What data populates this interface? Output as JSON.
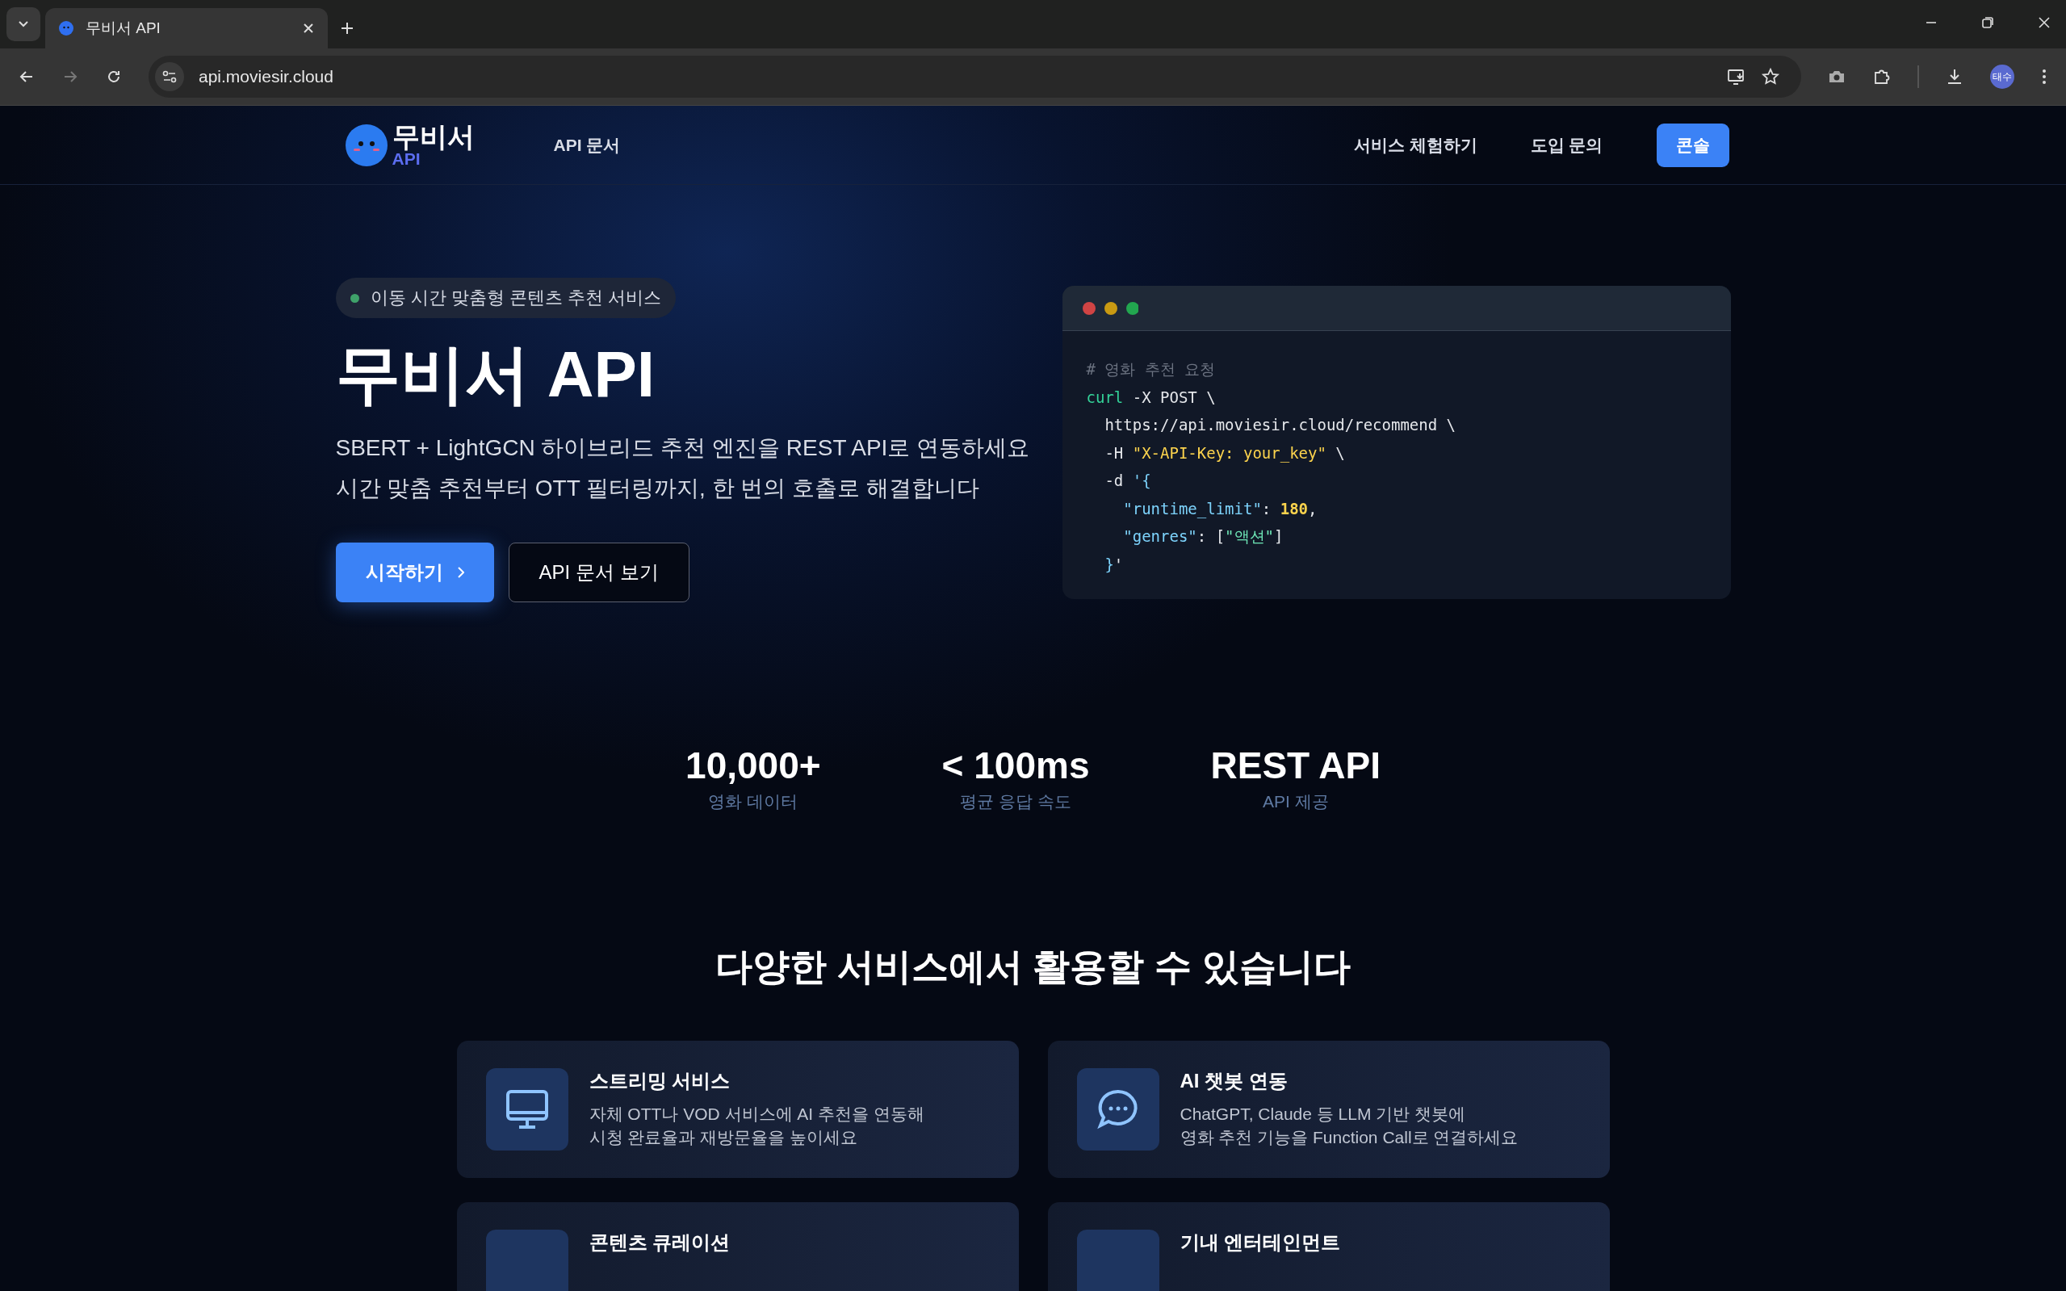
{
  "browser": {
    "tab_title": "무비서 API",
    "url": "api.moviesir.cloud",
    "profile": "태수"
  },
  "nav": {
    "logo_text": "무비서",
    "logo_sub": "API",
    "links": [
      {
        "label": "API 문서"
      }
    ],
    "right_links": [
      {
        "label": "서비스 체험하기"
      },
      {
        "label": "도입 문의"
      }
    ],
    "console_button": "콘솔"
  },
  "hero": {
    "badge": "이동 시간 맞춤형 콘텐츠 추천 서비스",
    "title": "무비서 API",
    "subtitle": [
      "SBERT + LightGCN 하이브리드 추천 엔진을 REST API로 연동하세요",
      "시간 맞춤 추천부터 OTT 필터링까지, 한 번의 호출로 해결합니다"
    ],
    "buttons": [
      {
        "label": "시작하기",
        "kind": "primary"
      },
      {
        "label": "API 문서 보기",
        "kind": "outline"
      }
    ]
  },
  "code": {
    "lines": [
      [
        {
          "t": "# 영화 추천 요청",
          "kind": "comment"
        }
      ],
      [
        {
          "t": "curl",
          "kind": "command"
        },
        {
          "t": " -X POST \\",
          "kind": "plain"
        }
      ],
      [
        {
          "t": "  https://api.moviesir.cloud/recommend \\",
          "kind": "plain"
        }
      ],
      [
        {
          "t": "  -H ",
          "kind": "plain"
        },
        {
          "t": "\"X-API-Key: your_key\"",
          "kind": "string"
        },
        {
          "t": " \\",
          "kind": "plain"
        }
      ],
      [
        {
          "t": "  -d ",
          "kind": "plain"
        },
        {
          "t": "'{",
          "kind": "brace"
        }
      ],
      [
        {
          "t": "    \"runtime_limit\"",
          "kind": "key"
        },
        {
          "t": ": ",
          "kind": "plain"
        },
        {
          "t": "180",
          "kind": "number"
        },
        {
          "t": ",",
          "kind": "plain"
        }
      ],
      [
        {
          "t": "    \"genres\"",
          "kind": "key"
        },
        {
          "t": ": [",
          "kind": "plain"
        },
        {
          "t": "\"액션\"",
          "kind": "value"
        },
        {
          "t": "]",
          "kind": "plain"
        }
      ],
      [
        {
          "t": "  }",
          "kind": "brace"
        },
        {
          "t": "'",
          "kind": "plain"
        }
      ]
    ]
  },
  "stats": [
    {
      "value": "10,000+",
      "label": "영화 데이터"
    },
    {
      "value": "< 100ms",
      "label": "평균 응답 속도"
    },
    {
      "value": "REST API",
      "label": "API 제공"
    }
  ],
  "section": {
    "title": "다양한 서비스에서 활용할 수 있습니다",
    "cards": [
      {
        "kind": "monitor",
        "title": "스트리밍 서비스",
        "lines": [
          "자체 OTT나 VOD 서비스에 AI 추천을 연동해",
          "시청 완료율과 재방문율을 높이세요"
        ]
      },
      {
        "kind": "chat",
        "title": "AI 챗봇 연동",
        "lines": [
          "ChatGPT, Claude 등 LLM 기반 챗봇에",
          "영화 추천 기능을 Function Call로 연결하세요"
        ]
      },
      {
        "title": "콘텐츠 큐레이션"
      },
      {
        "title": "기내 엔터테인먼트"
      }
    ]
  }
}
